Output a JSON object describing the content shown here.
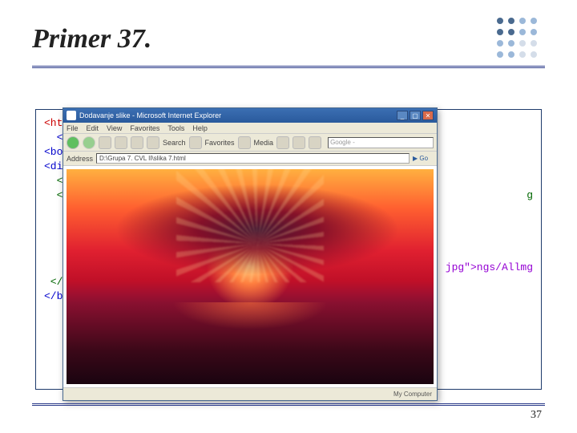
{
  "slide": {
    "title": "Primer 37.",
    "page_number": "37"
  },
  "code": {
    "l1a": "<html>",
    "l2a": "  <he",
    "l3a": "<body>",
    "l4a": "<div a",
    "l5a": "  <ta",
    "l6a": "  <tr",
    "l6_right_g": "g",
    "mid_right_mg": "mg",
    "mid_right_path1": "ngs/All",
    "mid_right_path2": "jpg\">",
    "end1": " </t",
    "end2": "</body"
  },
  "browser": {
    "title_text": "Dodavanje slike - Microsoft Internet Explorer",
    "menu": {
      "file": "File",
      "edit": "Edit",
      "view": "View",
      "favorites": "Favorites",
      "tools": "Tools",
      "help": "Help"
    },
    "toolbar_labels": {
      "back": "Back",
      "search": "Search",
      "favorites": "Favorites",
      "media": "Media"
    },
    "google_placeholder": "Google -",
    "address_label": "Address",
    "address_value": "D:\\Grupa 7. CVL II\\slika 7.html",
    "go_label": "Go",
    "status_left": "",
    "status_right": "My Computer"
  }
}
